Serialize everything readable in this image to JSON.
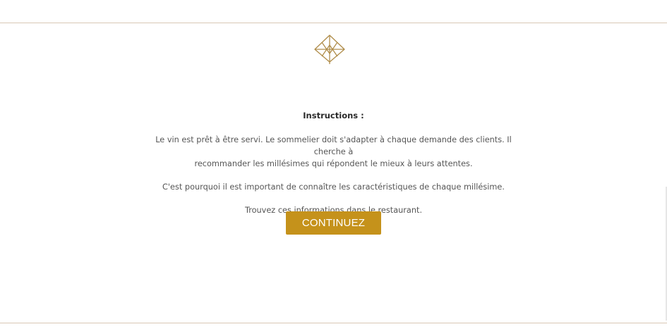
{
  "instructions": {
    "title": "Instructions :",
    "paragraph_1_line_1": "Le vin est prêt à être servi. Le sommelier doit s'adapter à chaque demande des clients. Il cherche à",
    "paragraph_1_line_2": "recommander les millésimes qui répondent le mieux à leurs attentes.",
    "paragraph_2": "C'est pourquoi il est important de connaître les caractéristiques de chaque millésime.",
    "paragraph_3": "Trouvez ces informations dans le restaurant."
  },
  "continue_button": {
    "label": "CONTINUEZ"
  },
  "colors": {
    "accent": "#c5921b",
    "logo": "#b08d4a",
    "rule": "#d8c7b5"
  },
  "icons": {
    "logo": "leaf-diamond-logo-icon"
  }
}
